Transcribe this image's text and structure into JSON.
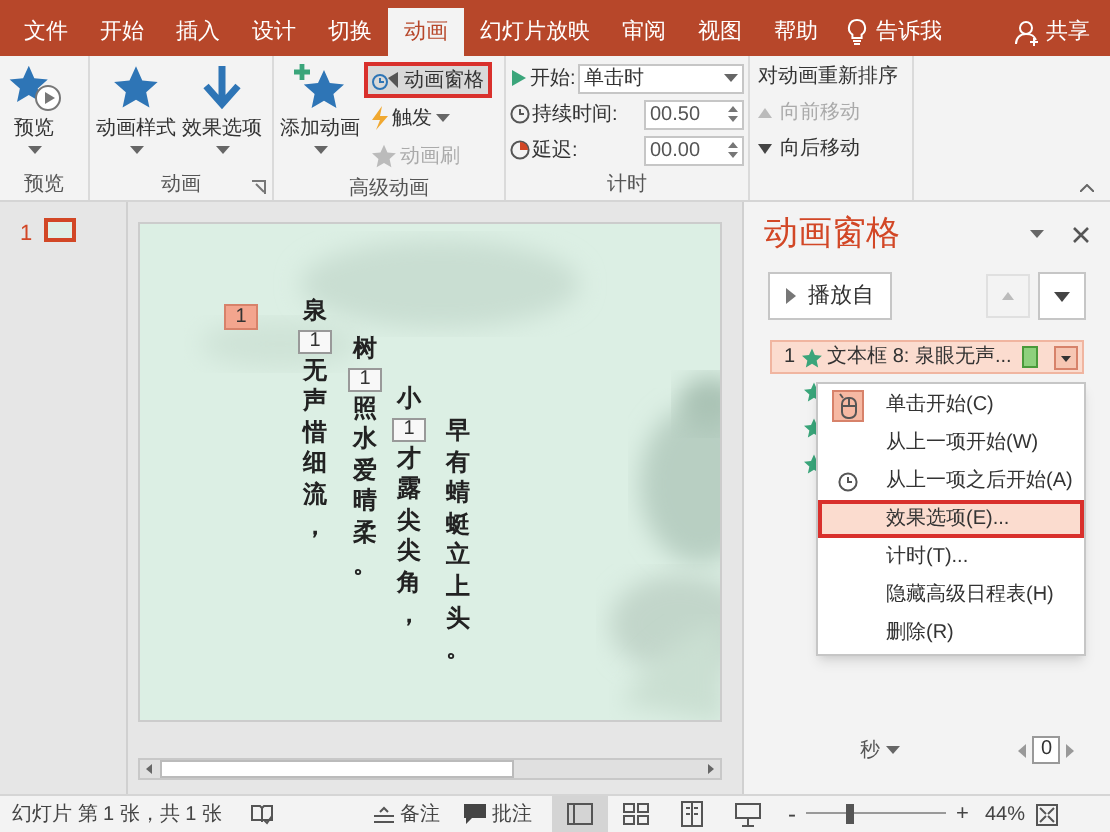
{
  "tabs": [
    {
      "label": "文件",
      "selected": false
    },
    {
      "label": "开始",
      "selected": false
    },
    {
      "label": "插入",
      "selected": false
    },
    {
      "label": "设计",
      "selected": false
    },
    {
      "label": "切换",
      "selected": false
    },
    {
      "label": "动画",
      "selected": true
    },
    {
      "label": "幻灯片放映",
      "selected": false
    },
    {
      "label": "审阅",
      "selected": false
    },
    {
      "label": "视图",
      "selected": false
    },
    {
      "label": "帮助",
      "selected": false
    }
  ],
  "tell_me": "告诉我",
  "share": "共享",
  "ribbon": {
    "preview": {
      "label": "预览",
      "group_label": "预览"
    },
    "animation": {
      "buttons": [
        {
          "kind": "style",
          "label": "动画样式"
        },
        {
          "kind": "effect",
          "label": "效果选项"
        }
      ],
      "group_label": "动画"
    },
    "advanced": {
      "add_label": "添加动画",
      "buttons": [
        {
          "kind": "pane",
          "label": "动画窗格",
          "selected": true,
          "disabled": false
        },
        {
          "kind": "trigger",
          "label": "触发",
          "selected": false,
          "disabled": false
        },
        {
          "kind": "painter",
          "label": "动画刷",
          "selected": false,
          "disabled": true
        }
      ],
      "group_label": "高级动画"
    },
    "timing": {
      "fields": [
        {
          "kind": "dropdown",
          "label": "开始:",
          "value": "单击时"
        },
        {
          "kind": "spinner",
          "label": "持续时间:",
          "value": "00.50"
        },
        {
          "kind": "spinner",
          "label": "延迟:",
          "value": "00.00"
        }
      ],
      "group_label": "计时"
    },
    "reorder": {
      "title": "对动画重新排序",
      "buttons": [
        {
          "kind": "up",
          "label": "向前移动",
          "disabled": true
        },
        {
          "kind": "down",
          "label": "向后移动",
          "disabled": false
        }
      ]
    }
  },
  "thumbnails": [
    {
      "number": "1",
      "selected": true
    }
  ],
  "slide": {
    "tag": {
      "label": "1",
      "selected": true
    },
    "columns": [
      {
        "top": "泉",
        "badge": "1",
        "bottom": "无声惜细流，"
      },
      {
        "top": "树",
        "badge": "1",
        "bottom": "照水爱晴柔。"
      },
      {
        "top": "小",
        "badge": "1",
        "bottom": "才露尖尖角，"
      },
      {
        "top": "早有蜻蜓立上头。"
      }
    ]
  },
  "pane": {
    "title": "动画窗格",
    "play_label": "播放自",
    "items": [
      {
        "number": "1",
        "label": "文本框 8: 泉眼无声...",
        "selected": true
      }
    ],
    "menu": [
      {
        "kind": "mouse",
        "label": "单击开始(C)",
        "selected": false
      },
      {
        "kind": "plain",
        "label": "从上一项开始(W)",
        "selected": false
      },
      {
        "kind": "clock",
        "label": "从上一项之后开始(A)",
        "selected": false
      },
      {
        "kind": "plain",
        "label": "效果选项(E)...",
        "selected": true
      },
      {
        "kind": "plain",
        "label": "计时(T)...",
        "selected": false
      },
      {
        "kind": "plain",
        "label": "隐藏高级日程表(H)",
        "selected": false
      },
      {
        "kind": "plain",
        "label": "删除(R)",
        "selected": false
      }
    ],
    "unit": "秒",
    "counter": "0"
  },
  "status": {
    "slide_info": "幻灯片 第 1 张，共 1 张",
    "notes": "备注",
    "comments": "批注",
    "views": [
      {
        "kind": "normal",
        "selected": true
      },
      {
        "kind": "sorter",
        "selected": false
      },
      {
        "kind": "reading",
        "selected": false
      },
      {
        "kind": "show",
        "selected": false
      }
    ],
    "zoom_out": "-",
    "zoom_in": "+",
    "zoom": "44%",
    "level": 0.3
  }
}
